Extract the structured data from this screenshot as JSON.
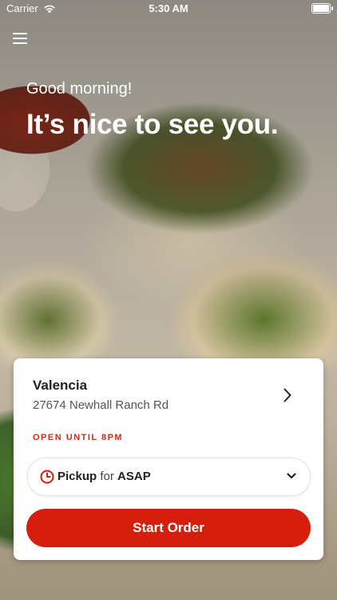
{
  "status_bar": {
    "carrier": "Carrier",
    "time": "5:30 AM"
  },
  "header": {
    "menu_icon": "hamburger-menu-icon"
  },
  "greeting": {
    "small": "Good morning!",
    "large": "It’s nice to see you."
  },
  "location": {
    "name": "Valencia",
    "address": "27674 Newhall Ranch Rd",
    "hours": "OPEN UNTIL 8PM",
    "chevron_icon": "chevron-right-icon"
  },
  "order_mode": {
    "mode": "Pickup",
    "connector": "for",
    "time": "ASAP",
    "clock_icon": "clock-icon",
    "dropdown_icon": "chevron-down-icon"
  },
  "cta": {
    "label": "Start Order"
  },
  "colors": {
    "accent": "#d51f0c",
    "hours_text": "#d42b14"
  }
}
